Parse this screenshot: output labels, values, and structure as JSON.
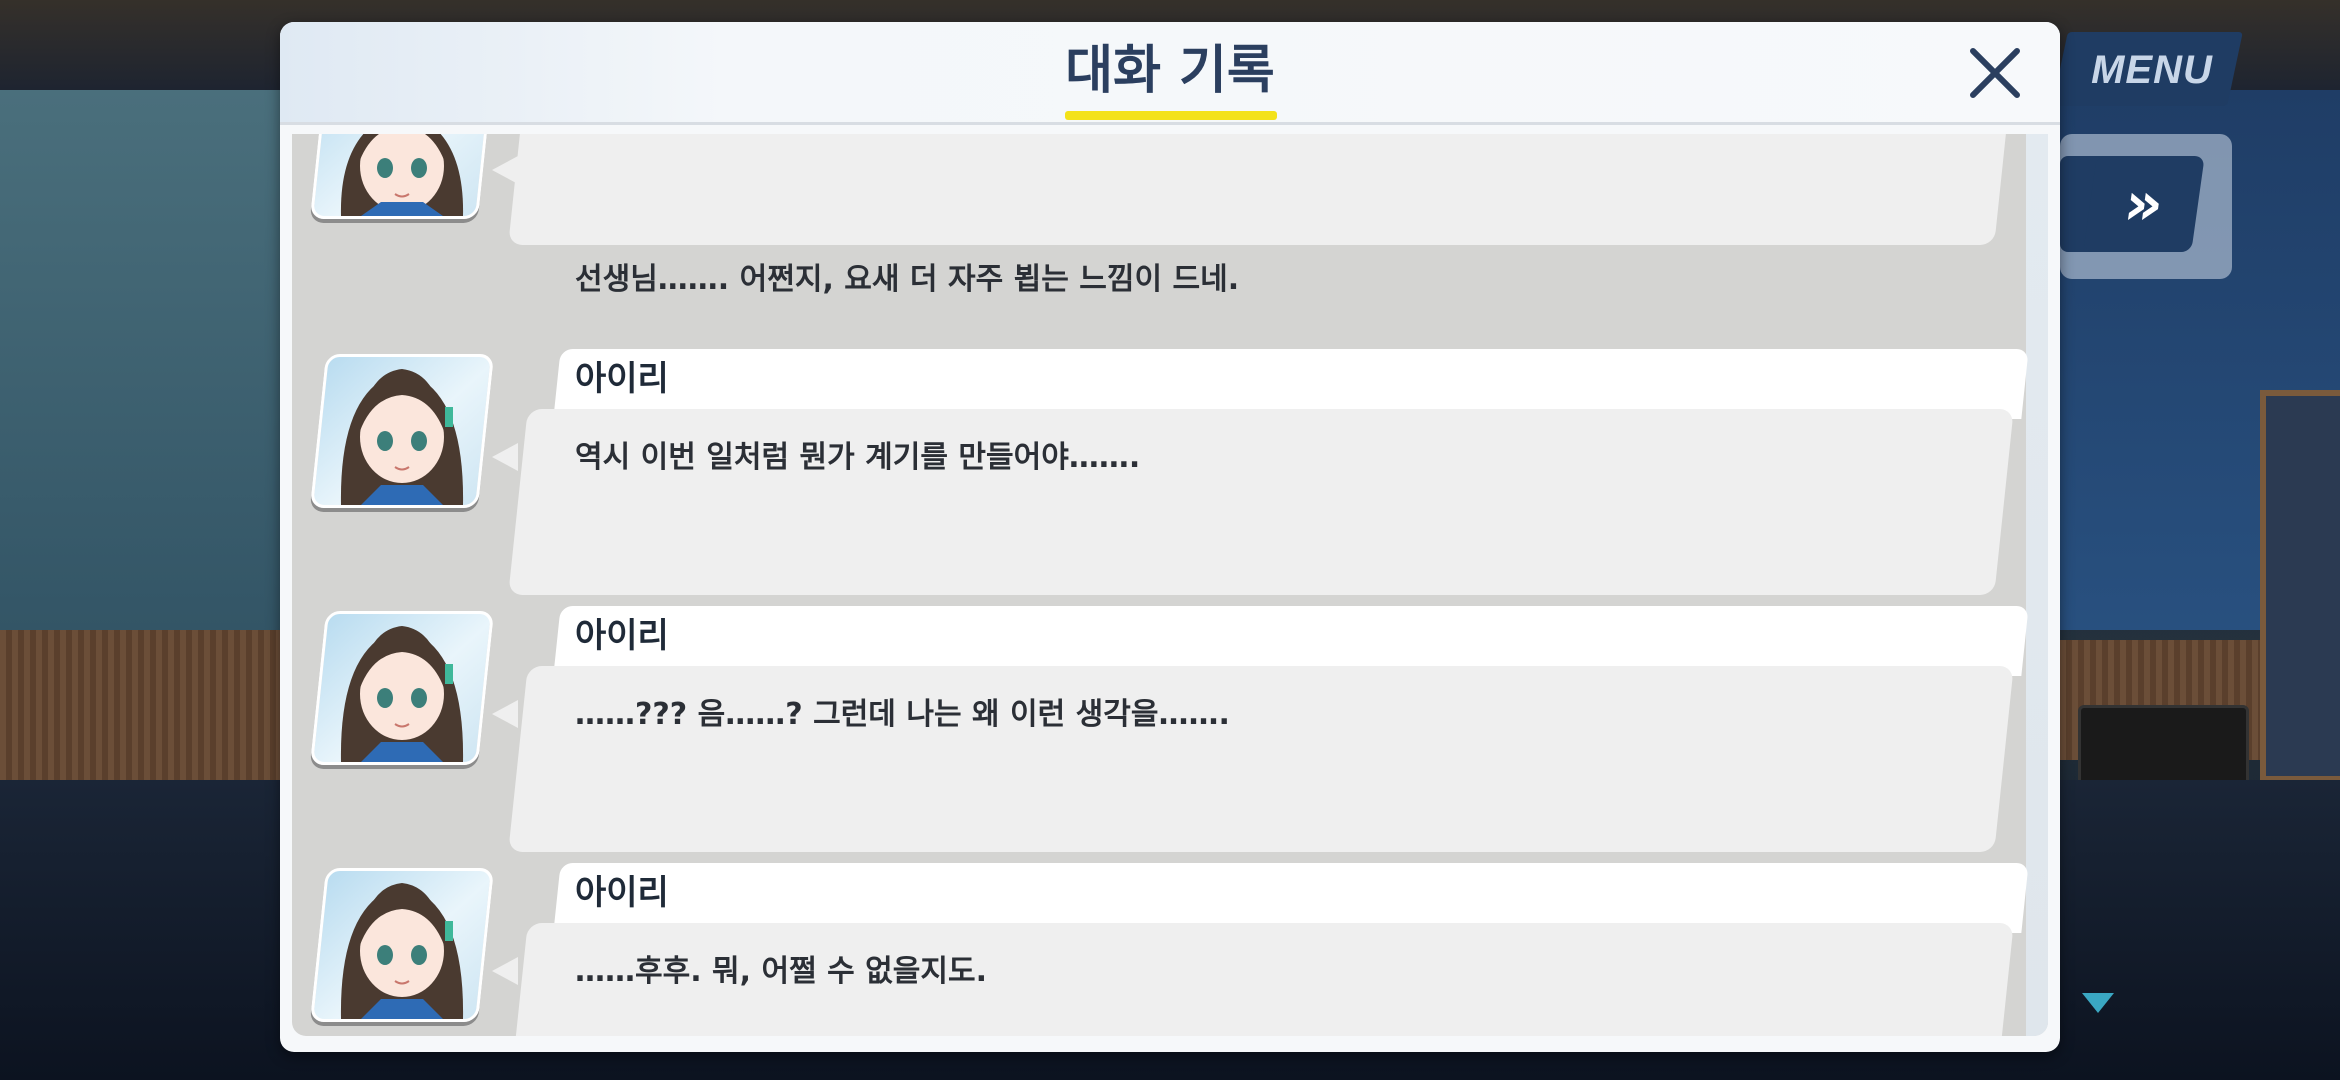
{
  "dialog": {
    "title": "대화 기록",
    "close_icon": "close-x-icon"
  },
  "hud": {
    "menu_label": "MENU",
    "fast_forward_label": "»",
    "fast_forward_icon": "fast-forward-icon",
    "scroll_indicator_icon": "scroll-down-arrow-icon"
  },
  "colors": {
    "title": "#2b3f5f",
    "title_underline": "#f3e21a",
    "hud_button": "#1f3c63",
    "bubble": "#efefef",
    "log_background": "#d4d4d2"
  },
  "log": [
    {
      "speaker": "",
      "text": "선생님……. 어쩐지, 요새 더 자주 뵙는 느낌이 드네.",
      "portrait": "airi-portrait-icon"
    },
    {
      "speaker": "아이리",
      "text": "역시 이번 일처럼 뭔가 계기를 만들어야…….",
      "portrait": "airi-portrait-icon"
    },
    {
      "speaker": "아이리",
      "text": "……??? 음……? 그런데 나는 왜 이런 생각을…….",
      "portrait": "airi-portrait-icon"
    },
    {
      "speaker": "아이리",
      "text": "……후후. 뭐, 어쩔 수 없을지도.",
      "portrait": "airi-portrait-icon"
    }
  ]
}
